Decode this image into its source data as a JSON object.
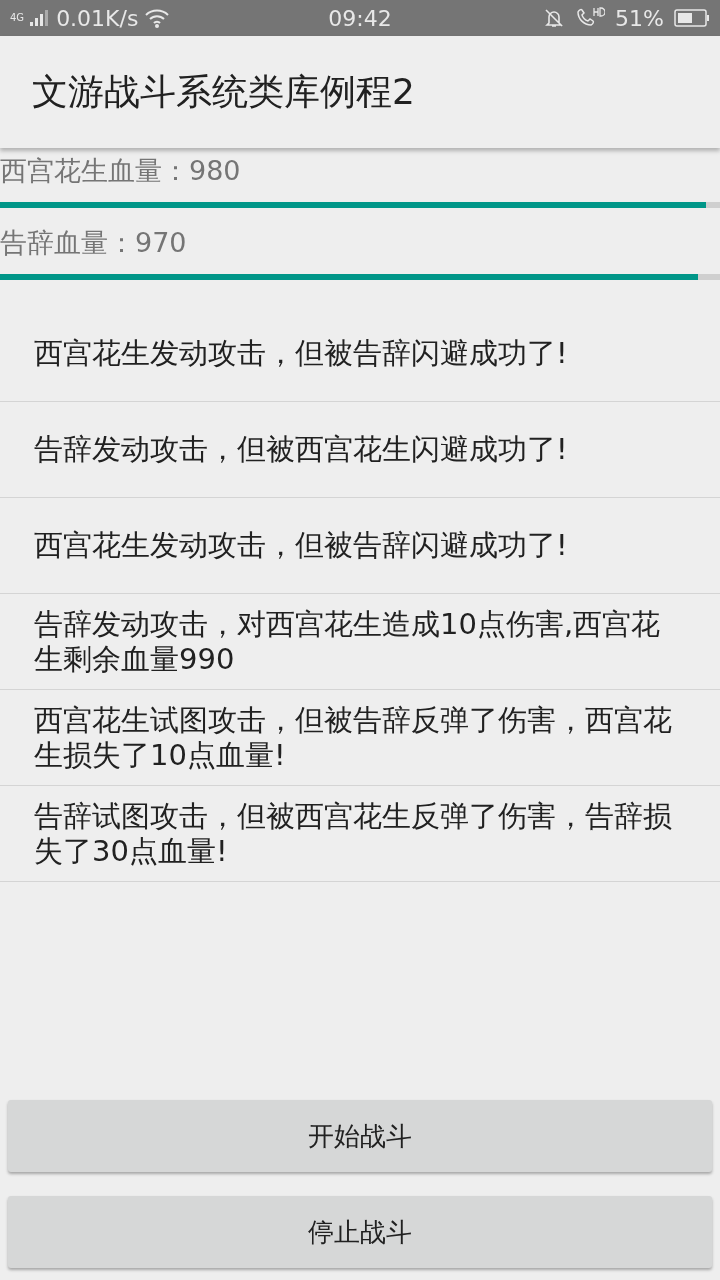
{
  "status_bar": {
    "network": "4G",
    "speed": "0.01K/s",
    "time": "09:42",
    "battery": "51%"
  },
  "app_bar": {
    "title": "文游战斗系统类库例程2"
  },
  "health": [
    {
      "label": "西宫花生血量：980",
      "level": 0.98
    },
    {
      "label": "告辞血量：970",
      "level": 0.97
    }
  ],
  "log": [
    "西宫花生发动攻击，但被告辞闪避成功了!",
    "告辞发动攻击，但被西宫花生闪避成功了!",
    "西宫花生发动攻击，但被告辞闪避成功了!",
    "告辞发动攻击，对西宫花生造成10点伤害,西宫花生剩余血量990",
    "西宫花生试图攻击，但被告辞反弹了伤害，西宫花生损失了10点血量!",
    "告辞试图攻击，但被西宫花生反弹了伤害，告辞损失了30点血量!"
  ],
  "buttons": [
    "开始战斗",
    "停止战斗"
  ]
}
